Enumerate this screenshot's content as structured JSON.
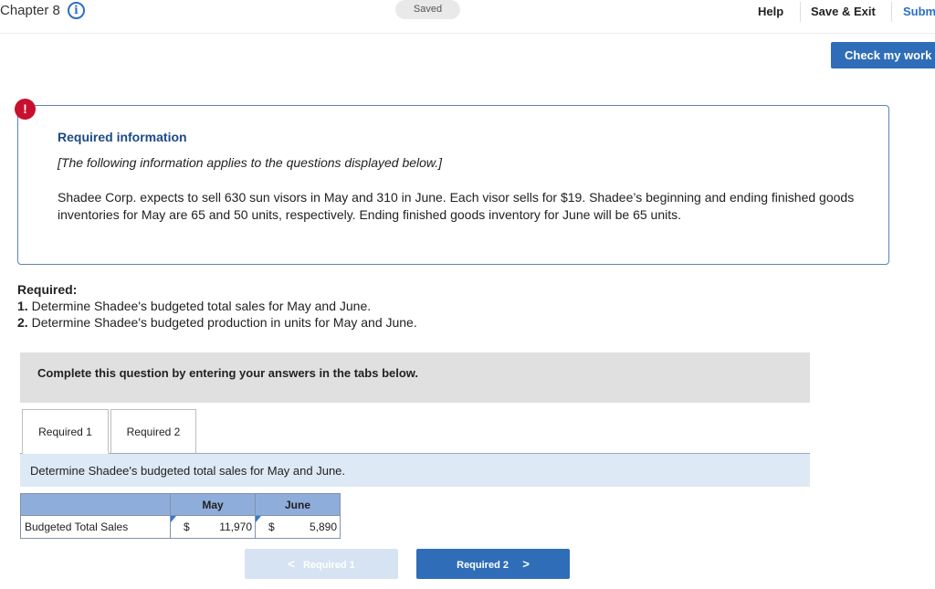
{
  "header": {
    "chapter_label": "Chapter 8",
    "saved_label": "Saved",
    "help_label": "Help",
    "save_exit_label": "Save & Exit",
    "submit_label": "Subm"
  },
  "check_work_label": "Check my work",
  "required_info": {
    "alert_symbol": "!",
    "title": "Required information",
    "subtitle": "[The following information applies to the questions displayed below.]",
    "body": "Shadee Corp. expects to sell 630 sun visors in May and 310 in June. Each visor sells for $19. Shadee’s beginning and ending finished goods inventories for May are 65 and 50 units, respectively. Ending finished goods inventory for June will be 65 units."
  },
  "required": {
    "heading": "Required:",
    "items": [
      {
        "num": "1.",
        "text": " Determine Shadee's budgeted total sales for May and June."
      },
      {
        "num": "2.",
        "text": " Determine Shadee's budgeted production in units for May and June."
      }
    ]
  },
  "instruction": "Complete this question by entering your answers in the tabs below.",
  "tabs": [
    {
      "label": "Required 1",
      "active": true
    },
    {
      "label": "Required 2",
      "active": false
    }
  ],
  "question_text": "Determine Shadee's budgeted total sales for May and June.",
  "answer_table": {
    "columns": [
      "May",
      "June"
    ],
    "row_label": "Budgeted Total Sales",
    "currency_symbol": "$",
    "values": [
      "11,970",
      "5,890"
    ]
  },
  "nav": {
    "prev_label": "Required 1",
    "next_label": "Required 2",
    "prev_chevron": "<",
    "next_chevron": ">"
  },
  "colors": {
    "accent": "#2f6db8",
    "alert": "#c8102e",
    "table_header": "#8eaddb"
  }
}
